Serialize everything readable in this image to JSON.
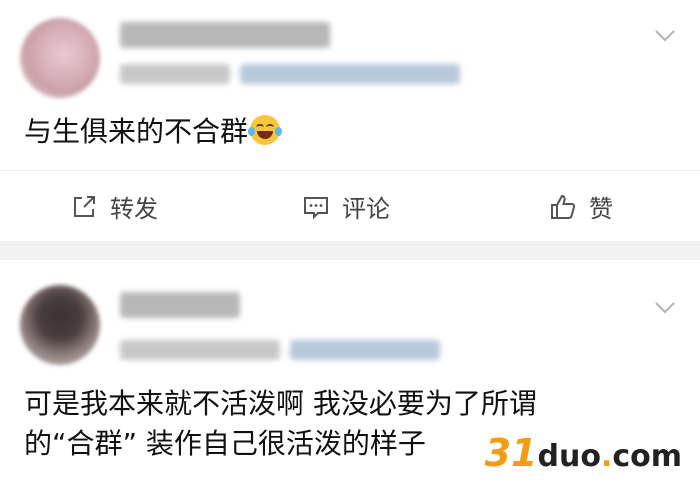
{
  "posts": [
    {
      "content_parts": [
        "与生俱来的不合群"
      ],
      "emoji_icon": "laughing-crying-emoji",
      "actions": {
        "forward_label": "转发",
        "comment_label": "评论",
        "like_label": "赞"
      }
    },
    {
      "content_lines": [
        "可是我本来就不活泼啊 我没必要为了所谓",
        "的“合群” 装作自己很活泼的样子"
      ]
    }
  ],
  "watermark": {
    "num": "31",
    "word": "duo",
    "dot": ".",
    "tld": "com"
  },
  "colors": {
    "separator": "#f2f2f2",
    "watermark_accent": "#f39c12",
    "text": "#111111"
  }
}
